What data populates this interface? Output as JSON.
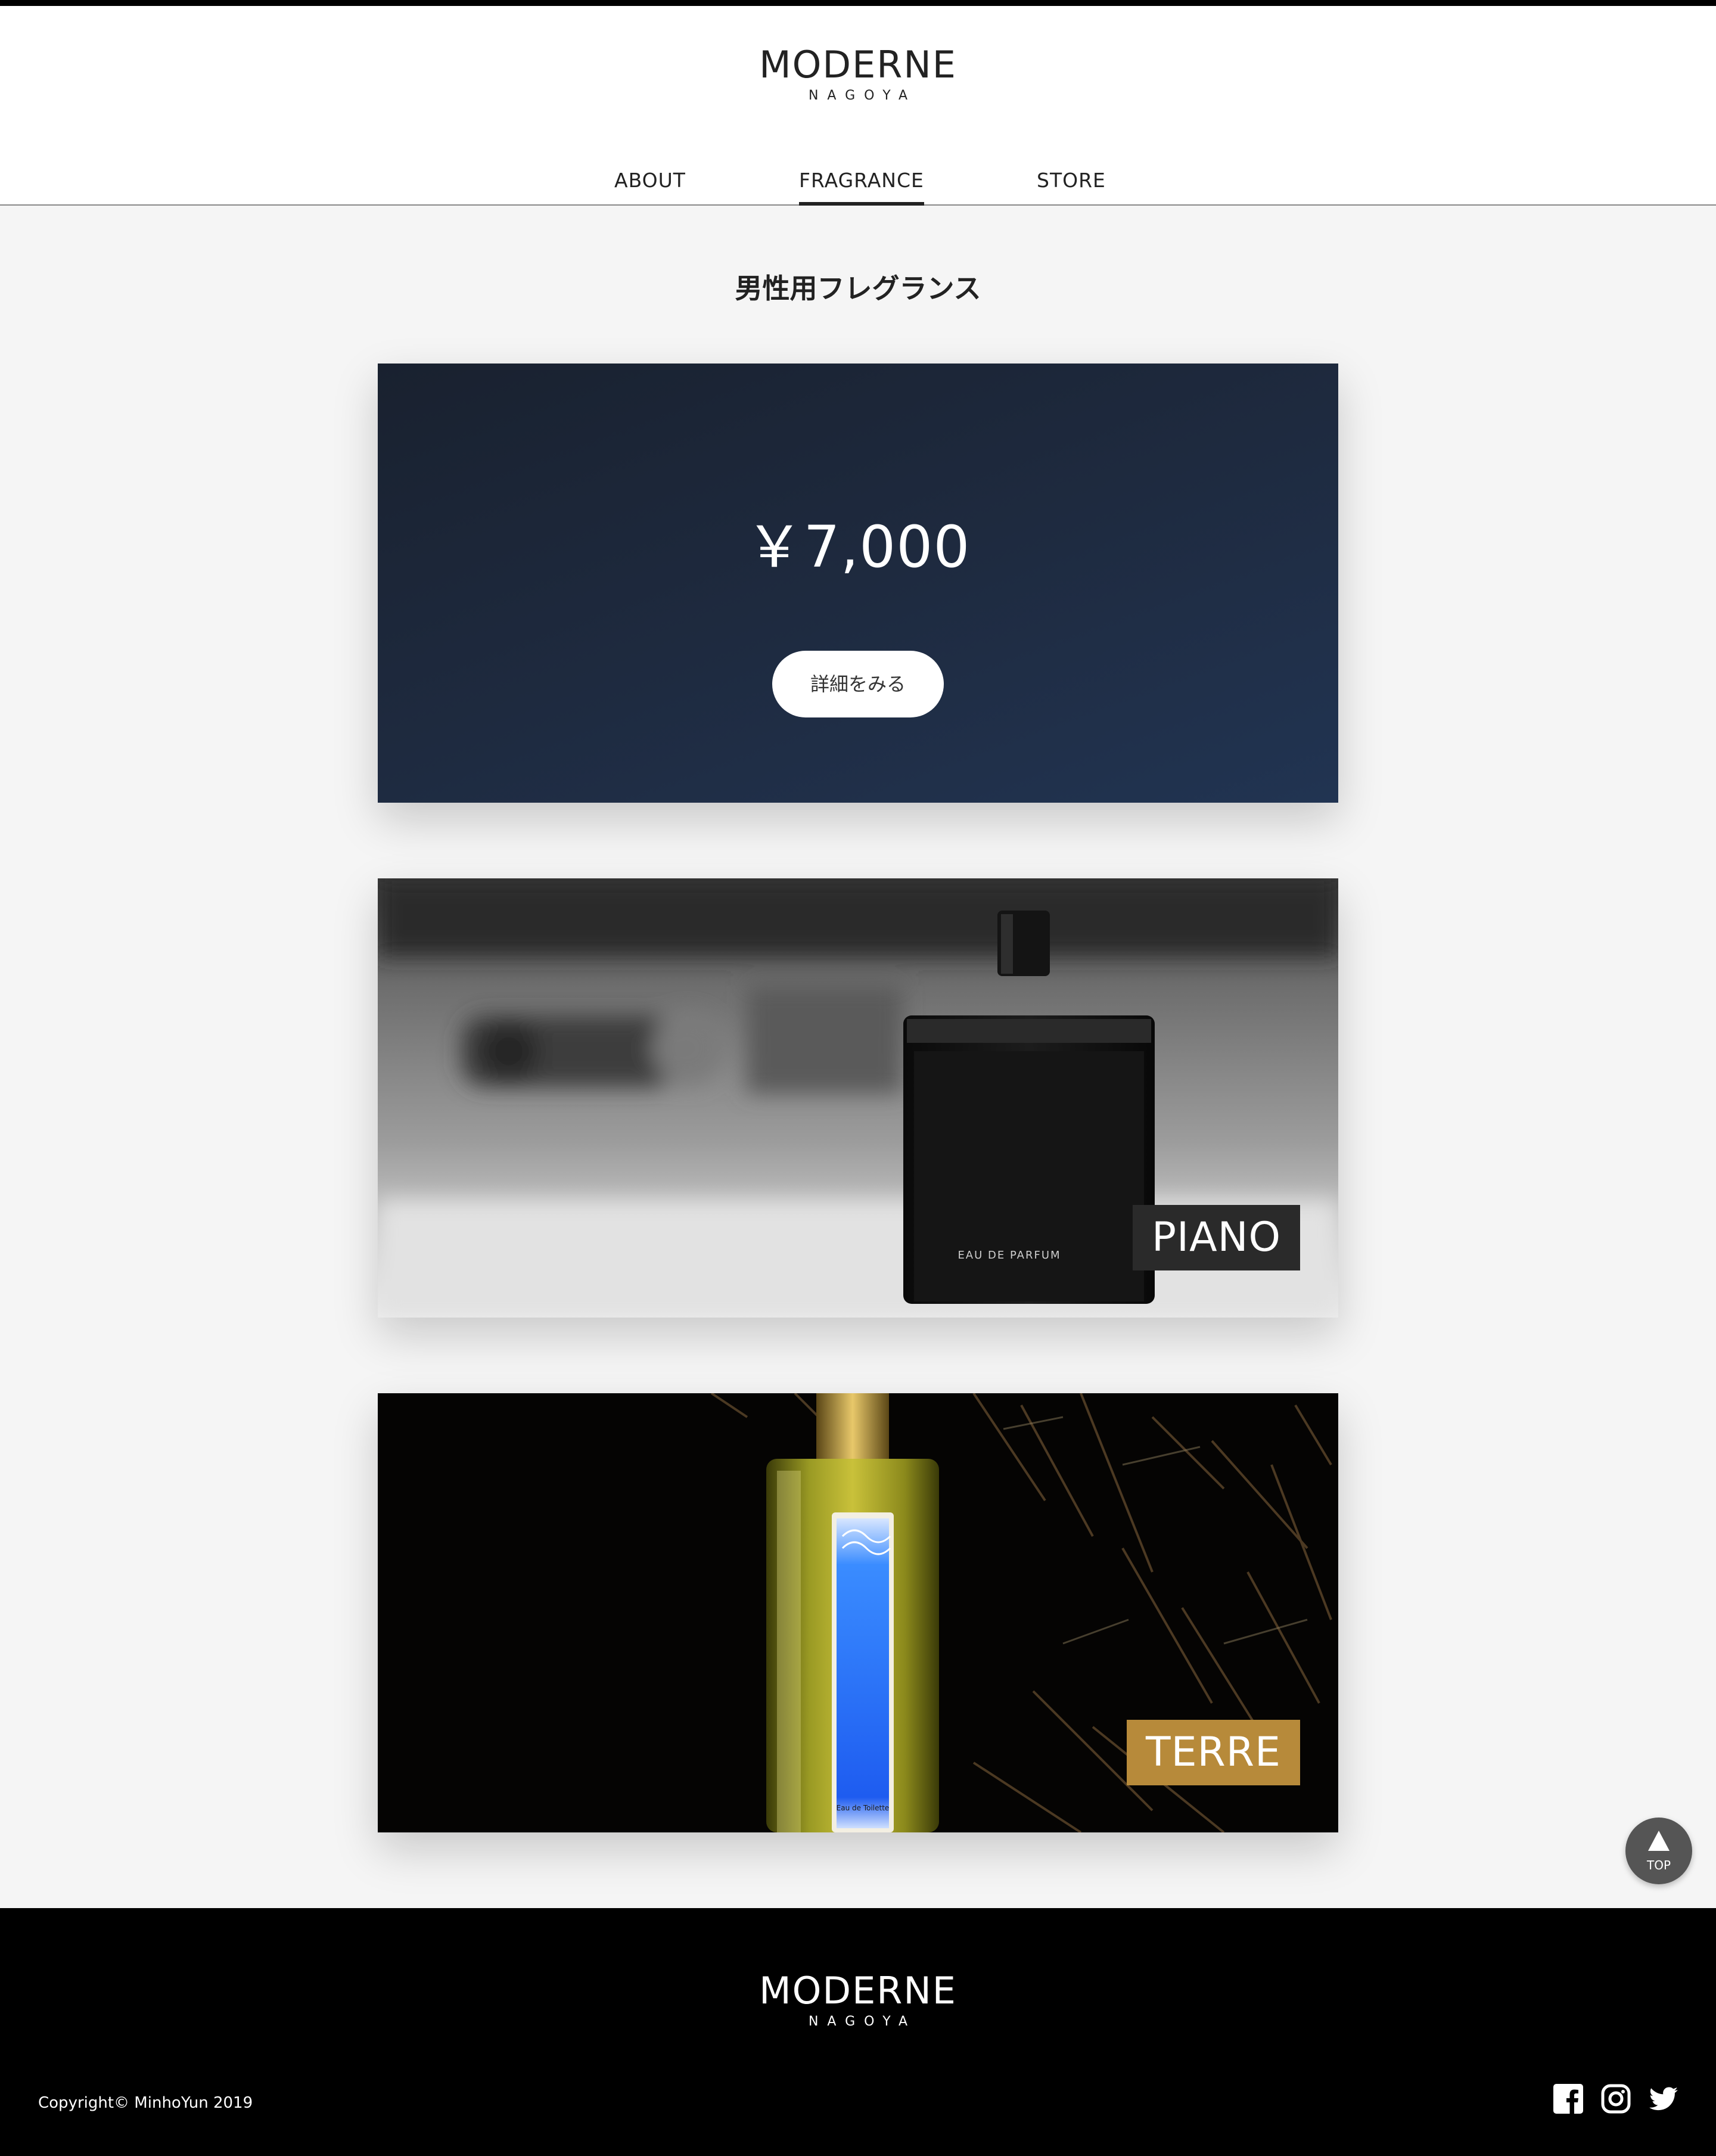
{
  "header": {
    "logo_main": "MODERNE",
    "logo_sub": "NAGOYA",
    "nav": [
      {
        "label": "ABOUT"
      },
      {
        "label": "FRAGRANCE",
        "active": true
      },
      {
        "label": "STORE"
      }
    ]
  },
  "main": {
    "title": "男性用フレグランス",
    "cards": [
      {
        "price": "￥7,000",
        "button_label": "詳細をみる"
      },
      {
        "name": "PIANO",
        "bottle_label": "EAU DE PARFUM"
      },
      {
        "name": "TERRE",
        "bottle_label": "Eau de Toilette"
      }
    ]
  },
  "top_button": {
    "label": "TOP",
    "icon": "arrow-up-icon"
  },
  "footer": {
    "logo_main": "MODERNE",
    "logo_sub": "NAGOYA",
    "copyright": "Copyright© MinhoYun 2019",
    "social": [
      {
        "icon": "facebook-icon"
      },
      {
        "icon": "instagram-icon"
      },
      {
        "icon": "twitter-icon"
      }
    ]
  },
  "colors": {
    "card1_bg": "#1e2a3f",
    "piano_tag": "#2a2a2a",
    "terre_tag": "#b78a3a"
  }
}
